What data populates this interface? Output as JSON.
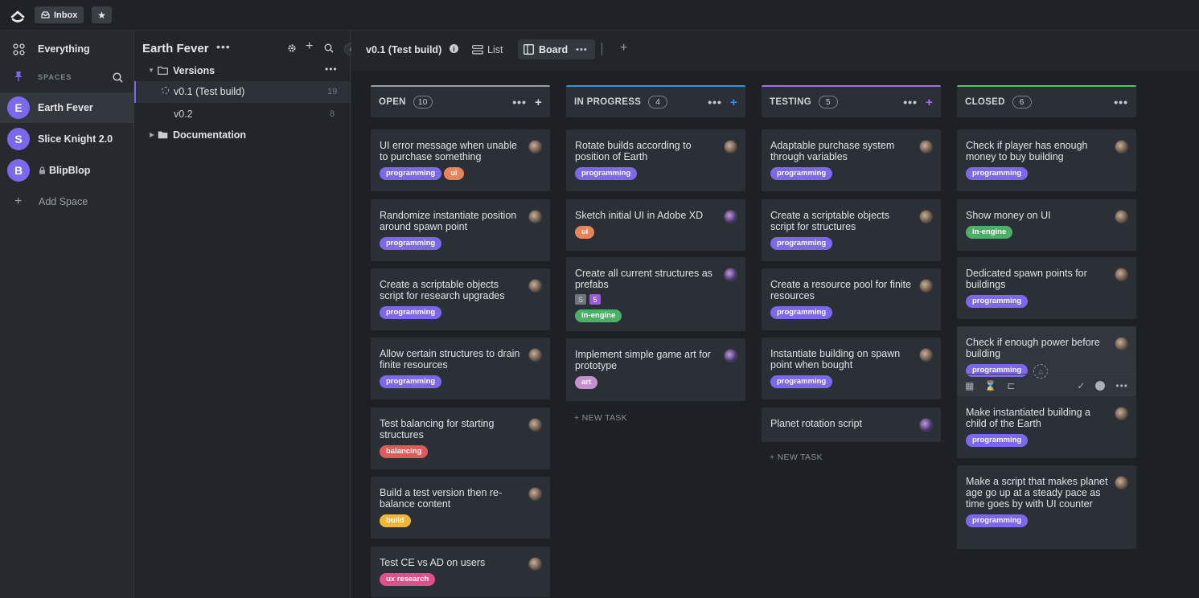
{
  "topbar": {
    "inbox_label": "Inbox"
  },
  "left": {
    "everything": "Everything",
    "spaces_label": "SPACES",
    "spaces": [
      {
        "letter": "E",
        "name": "Earth Fever"
      },
      {
        "letter": "S",
        "name": "Slice Knight 2.0"
      },
      {
        "letter": "B",
        "name": "BlipBlop"
      }
    ],
    "add_space": "Add Space"
  },
  "middle": {
    "space_title": "Earth Fever",
    "folder": "Versions",
    "lists": [
      {
        "name": "v0.1 (Test build)",
        "count": "19"
      },
      {
        "name": "v0.2",
        "count": "8"
      }
    ],
    "folder2": "Documentation"
  },
  "board": {
    "list_title": "v0.1 (Test build)",
    "view_list": "List",
    "view_board": "Board",
    "new_task": "+ NEW TASK"
  },
  "colors": {
    "programming": "#7b68ee",
    "ui": "#e8845a",
    "in-engine": "#4caf68",
    "balancing": "#e05a5a",
    "build": "#f0b53a",
    "ux research": "#e0508a",
    "art": "#c590cf"
  },
  "columns": [
    {
      "name": "OPEN",
      "count": "10",
      "color": "#9aa0a6",
      "plus_color": "#d0d3d7",
      "cards": [
        {
          "title": "UI error message when unable to purchase something",
          "tags": [
            "programming",
            "ui"
          ]
        },
        {
          "title": "Randomize instantiate position around spawn point",
          "tags": [
            "programming"
          ]
        },
        {
          "title": "Create a scriptable objects script for research upgrades",
          "tags": [
            "programming"
          ]
        },
        {
          "title": "Allow certain structures to drain finite resources",
          "tags": [
            "programming"
          ]
        },
        {
          "title": "Test balancing for starting structures",
          "tags": [
            "balancing"
          ]
        },
        {
          "title": "Build a test version then re-balance content",
          "tags": [
            "build"
          ]
        },
        {
          "title": "Test CE vs AD on users",
          "tags": [
            "ux research"
          ]
        }
      ]
    },
    {
      "name": "IN PROGRESS",
      "count": "4",
      "color": "#3a8ee6",
      "plus_color": "#3a8ee6",
      "cards": [
        {
          "title": "Rotate builds according to position of Earth",
          "tags": [
            "programming"
          ]
        },
        {
          "title": "Sketch initial UI in Adobe XD",
          "tags": [
            "ui"
          ]
        },
        {
          "title": "Create all current structures as prefabs",
          "tags": [
            "in-engine"
          ],
          "sub": "5"
        },
        {
          "title": "Implement simple game art for prototype",
          "tags": [
            "art"
          ]
        }
      ]
    },
    {
      "name": "TESTING",
      "count": "5",
      "color": "#a56ee8",
      "plus_color": "#a56ee8",
      "cards": [
        {
          "title": "Adaptable purchase system through variables",
          "tags": [
            "programming"
          ]
        },
        {
          "title": "Create a scriptable objects script for structures",
          "tags": [
            "programming"
          ]
        },
        {
          "title": "Create a resource pool for finite resources",
          "tags": [
            "programming"
          ]
        },
        {
          "title": "Instantiate building on spawn point when bought",
          "tags": [
            "programming"
          ]
        },
        {
          "title": "Planet rotation script",
          "tags": []
        }
      ]
    },
    {
      "name": "CLOSED",
      "count": "6",
      "color": "#5ac26a",
      "plus_color": "",
      "cards": [
        {
          "title": "Check if player has enough money to buy building",
          "tags": [
            "programming"
          ]
        },
        {
          "title": "Show money on UI",
          "tags": [
            "in-engine"
          ]
        },
        {
          "title": "Dedicated spawn points for buildings",
          "tags": [
            "programming"
          ]
        },
        {
          "title": "Check if enough power before building",
          "tags": [
            "programming"
          ]
        },
        {
          "title": "Make instantiated building a child of the Earth",
          "tags": [
            "programming"
          ]
        },
        {
          "title": "Make a script that makes planet age go up at a steady pace as time goes by with UI counter",
          "tags": [
            "programming"
          ]
        }
      ]
    }
  ]
}
